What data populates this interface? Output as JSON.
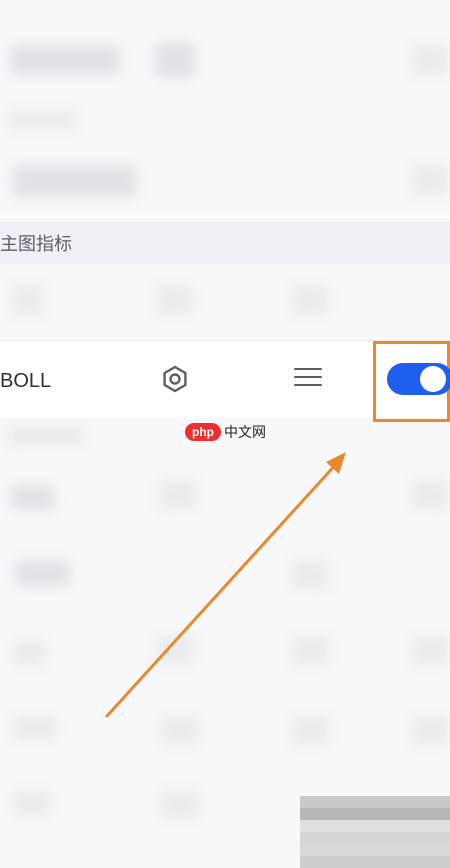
{
  "section": {
    "title": "主图指标"
  },
  "indicator_row": {
    "name": "BOLL",
    "toggle_on": true
  },
  "watermark": {
    "badge": "php",
    "text": "中文网"
  },
  "colors": {
    "accent": "#1e5ff0",
    "highlight_box": "#e8892f",
    "arrow": "#e8892f",
    "header_bg": "#f0f1f6"
  },
  "icons": {
    "settings": "hexagon-gear-icon",
    "menu": "hamburger-menu-icon"
  }
}
